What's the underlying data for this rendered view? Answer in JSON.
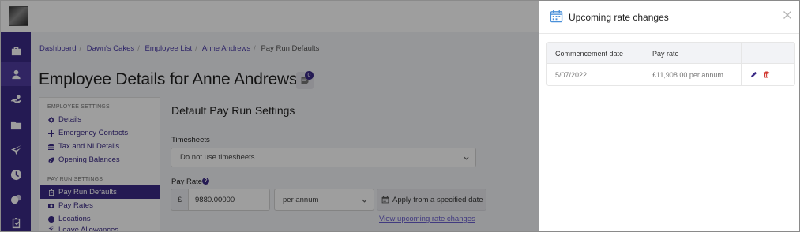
{
  "breadcrumb": {
    "items": [
      "Dashboard",
      "Dawn's Cakes",
      "Employee List",
      "Anne Andrews"
    ],
    "current": "Pay Run Defaults"
  },
  "page": {
    "title": "Employee Details for Anne Andrews",
    "badge_count": "0"
  },
  "settings_nav": {
    "employee_heading": "EMPLOYEE SETTINGS",
    "employee_items": [
      "Details",
      "Emergency Contacts",
      "Tax and NI Details",
      "Opening Balances"
    ],
    "payrun_heading": "PAY RUN SETTINGS",
    "payrun_items": [
      "Pay Run Defaults",
      "Pay Rates",
      "Locations",
      "Leave Allowances"
    ]
  },
  "content": {
    "title": "Default Pay Run Settings",
    "timesheets_label": "Timesheets",
    "timesheets_value": "Do not use timesheets",
    "pay_rate_label": "Pay Rate",
    "help_glyph": "?",
    "currency_symbol": "£",
    "pay_rate_value": "9880.00000",
    "pay_rate_period": "per annum",
    "apply_button": "Apply from a specified date",
    "upcoming_link": "View upcoming rate changes"
  },
  "drawer": {
    "title": "Upcoming rate changes",
    "table": {
      "headers": [
        "Commencement date",
        "Pay rate"
      ],
      "rows": [
        {
          "commencement_date": "5/07/2022",
          "pay_rate": "£11,908.00 per annum"
        }
      ]
    }
  },
  "icons": {
    "rail": [
      "briefcase-icon",
      "employees-icon",
      "payment-hand-icon",
      "folder-icon",
      "plane-icon",
      "clock-icon",
      "coins-icon",
      "clipboard-check-icon"
    ],
    "drawer_calendar": "calendar-icon",
    "close": "close-icon",
    "edit": "pencil-icon",
    "delete": "trash-icon"
  },
  "colors": {
    "brand": "#3b2a86",
    "link": "#4a3aa8",
    "delete": "#d0342c"
  }
}
